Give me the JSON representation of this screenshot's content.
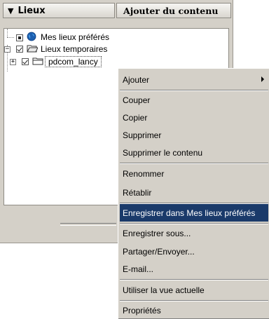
{
  "header": {
    "title": "Lieux",
    "add_content_label": "Ajouter du contenu"
  },
  "icons": {
    "collapse": "triangle-down-icon",
    "favorites": "globe-icon",
    "temporary": "folder-open-icon",
    "folder": "folder-icon"
  },
  "tree": {
    "nodes": [
      {
        "label": "Mes lieux préférés",
        "checked": "partial"
      },
      {
        "label": "Lieux temporaires",
        "checked": "checked"
      },
      {
        "label": "pdcom_lancy",
        "checked": "checked",
        "selected": true
      }
    ]
  },
  "context_menu": {
    "items": [
      {
        "label": "Ajouter",
        "has_submenu": true
      },
      {
        "label": "Couper"
      },
      {
        "label": "Copier"
      },
      {
        "label": "Supprimer"
      },
      {
        "label": "Supprimer le contenu"
      },
      {
        "label": "Renommer"
      },
      {
        "label": "Rétablir"
      },
      {
        "label": "Enregistrer dans Mes lieux préférés",
        "highlighted": true
      },
      {
        "label": "Enregistrer sous..."
      },
      {
        "label": "Partager/Envoyer..."
      },
      {
        "label": "E-mail..."
      },
      {
        "label": "Utiliser la vue actuelle"
      },
      {
        "label": "Propriétés"
      }
    ]
  },
  "colors": {
    "panel_bg": "#d4d0c8",
    "highlight_bg": "#1a3a6a",
    "highlight_text": "#ffffff"
  }
}
